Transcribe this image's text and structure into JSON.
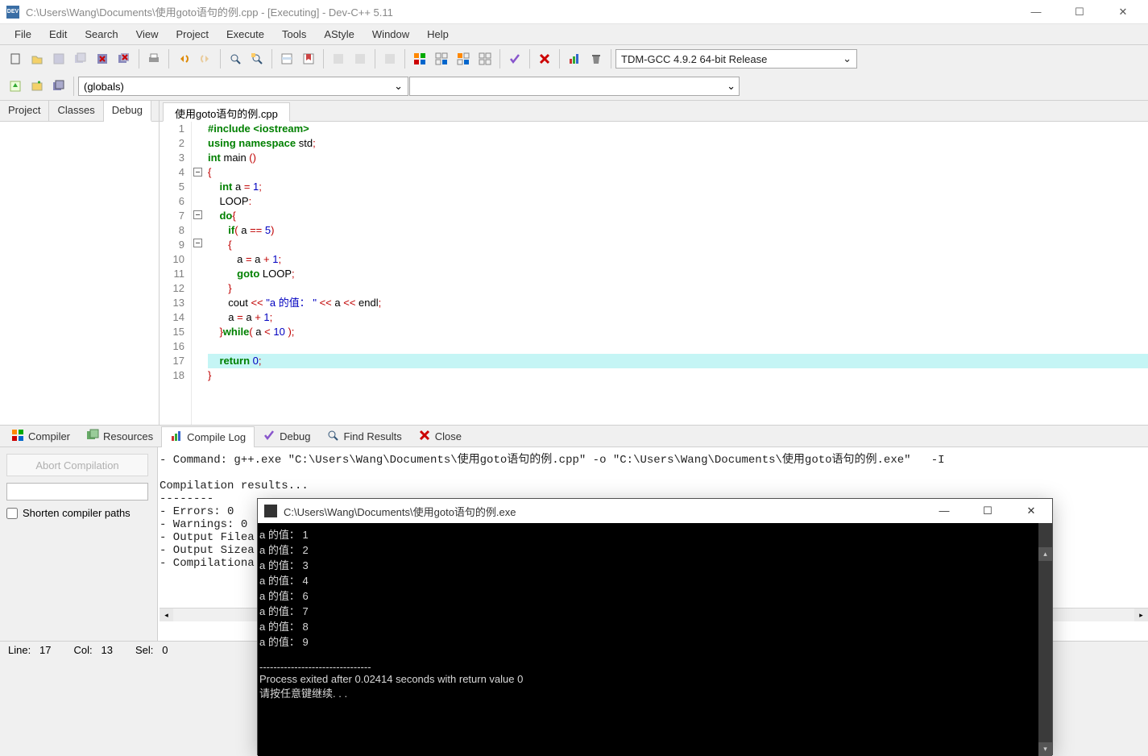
{
  "window": {
    "title": "C:\\Users\\Wang\\Documents\\使用goto语句的例.cpp - [Executing] - Dev-C++ 5.11"
  },
  "menu": [
    "File",
    "Edit",
    "Search",
    "View",
    "Project",
    "Execute",
    "Tools",
    "AStyle",
    "Window",
    "Help"
  ],
  "compiler_select": "TDM-GCC 4.9.2 64-bit Release",
  "globals_select": "(globals)",
  "left_tabs": [
    "Project",
    "Classes",
    "Debug"
  ],
  "left_active": "Debug",
  "editor_tab": "使用goto语句的例.cpp",
  "code": {
    "lines": [
      {
        "n": 1,
        "html": "<span class='pp'>#include</span> <span class='pp'>&lt;iostream&gt;</span>"
      },
      {
        "n": 2,
        "html": "<span class='kw'>using</span> <span class='kw'>namespace</span> std<span class='op'>;</span>"
      },
      {
        "n": 3,
        "html": "<span class='kw'>int</span> main <span class='br'>()</span>"
      },
      {
        "n": 4,
        "html": "<span class='br'>{</span>",
        "fold": true
      },
      {
        "n": 5,
        "html": "    <span class='kw'>int</span> a <span class='op'>=</span> <span class='num'>1</span><span class='op'>;</span>"
      },
      {
        "n": 6,
        "html": "    LOOP<span class='op'>:</span>"
      },
      {
        "n": 7,
        "html": "    <span class='kw'>do</span><span class='br'>{</span>",
        "fold": true
      },
      {
        "n": 8,
        "html": "       <span class='kw'>if</span><span class='br'>(</span> a <span class='op'>==</span> <span class='num'>5</span><span class='br'>)</span>"
      },
      {
        "n": 9,
        "html": "       <span class='br'>{</span>",
        "fold": true
      },
      {
        "n": 10,
        "html": "          a <span class='op'>=</span> a <span class='op'>+</span> <span class='num'>1</span><span class='op'>;</span>"
      },
      {
        "n": 11,
        "html": "          <span class='kw'>goto</span> LOOP<span class='op'>;</span>"
      },
      {
        "n": 12,
        "html": "       <span class='br'>}</span>"
      },
      {
        "n": 13,
        "html": "       cout <span class='op'>&lt;&lt;</span> <span class='str'>\"a 的值： \"</span> <span class='op'>&lt;&lt;</span> a <span class='op'>&lt;&lt;</span> endl<span class='op'>;</span>"
      },
      {
        "n": 14,
        "html": "       a <span class='op'>=</span> a <span class='op'>+</span> <span class='num'>1</span><span class='op'>;</span>"
      },
      {
        "n": 15,
        "html": "    <span class='br'>}</span><span class='kw'>while</span><span class='br'>(</span> a <span class='op'>&lt;</span> <span class='num'>10</span> <span class='br'>)</span><span class='op'>;</span>"
      },
      {
        "n": 16,
        "html": ""
      },
      {
        "n": 17,
        "html": "    <span class='kw'>return</span> <span class='num'>0</span><span class='op'>;</span>",
        "highlight": true
      },
      {
        "n": 18,
        "html": "<span class='br'>}</span>"
      }
    ]
  },
  "bottom_tabs": [
    {
      "label": "Compiler",
      "icon": "grid"
    },
    {
      "label": "Resources",
      "icon": "res"
    },
    {
      "label": "Compile Log",
      "icon": "chart",
      "active": true
    },
    {
      "label": "Debug",
      "icon": "check"
    },
    {
      "label": "Find Results",
      "icon": "search"
    },
    {
      "label": "Close",
      "icon": "close"
    }
  ],
  "abort_label": "Abort Compilation",
  "shorten_label": "Shorten compiler paths",
  "compile_log": "- Command: g++.exe \"C:\\Users\\Wang\\Documents\\使用goto语句的例.cpp\" -o \"C:\\Users\\Wang\\Documents\\使用goto语句的例.exe\"   -I\n\nCompilation results...\n--------\n- Errors: 0\n- Warnings: 0\n- Output Filea\n- Output Sizea\n- Compilationa",
  "statusbar": {
    "line_label": "Line:",
    "line": "17",
    "col_label": "Col:",
    "col": "13",
    "sel_label": "Sel:",
    "sel": "0"
  },
  "console": {
    "title": "C:\\Users\\Wang\\Documents\\使用goto语句的例.exe",
    "output": "a 的值： 1\na 的值： 2\na 的值： 3\na 的值： 4\na 的值： 6\na 的值： 7\na 的值： 8\na 的值： 9\n\n--------------------------------\nProcess exited after 0.02414 seconds with return value 0\n请按任意键继续. . ."
  }
}
